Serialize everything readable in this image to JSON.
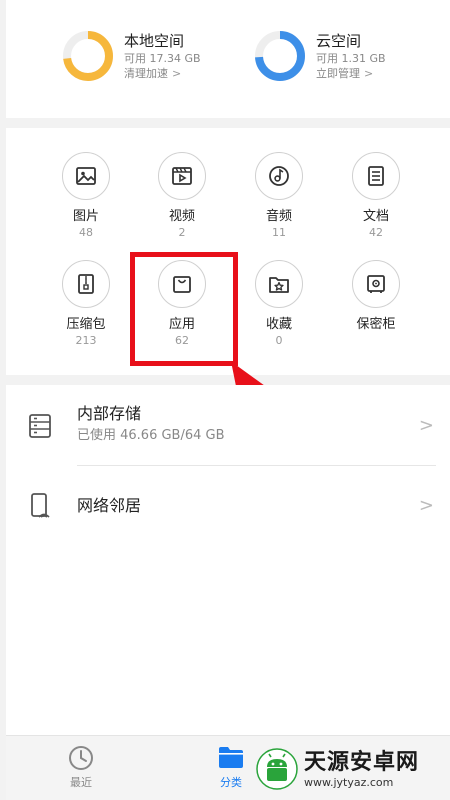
{
  "storage": {
    "local": {
      "title": "本地空间",
      "available": "可用 17.34 GB",
      "action": "清理加速",
      "ring_color": "#f6b73c",
      "used_fraction": 0.73
    },
    "cloud": {
      "title": "云空间",
      "available": "可用 1.31 GB",
      "action": "立即管理",
      "ring_color": "#3d8fe8",
      "used_fraction": 0.74
    }
  },
  "categories": [
    {
      "label": "图片",
      "count": "48",
      "icon": "image-icon"
    },
    {
      "label": "视频",
      "count": "2",
      "icon": "video-icon"
    },
    {
      "label": "音频",
      "count": "11",
      "icon": "music-icon"
    },
    {
      "label": "文档",
      "count": "42",
      "icon": "document-icon"
    },
    {
      "label": "压缩包",
      "count": "213",
      "icon": "zip-icon"
    },
    {
      "label": "应用",
      "count": "62",
      "icon": "bag-icon"
    },
    {
      "label": "收藏",
      "count": "0",
      "icon": "star-folder-icon"
    },
    {
      "label": "保密柜",
      "count": "",
      "icon": "safe-icon"
    }
  ],
  "list": {
    "internal": {
      "title": "内部存储",
      "sub": "已使用 46.66 GB/64 GB",
      "icon": "storage-icon"
    },
    "network": {
      "title": "网络邻居",
      "icon": "network-device-icon"
    }
  },
  "tabs": [
    {
      "label": "最近",
      "icon": "clock-icon",
      "color": "#888888"
    },
    {
      "label": "分类",
      "icon": "folder-icon",
      "color": "#1a7cf0"
    }
  ],
  "watermark": {
    "name": "天源安卓网",
    "url": "www.jytyaz.com",
    "colors": {
      "green": "#2aa43b"
    }
  },
  "annotation": {
    "color": "#e8101a"
  }
}
